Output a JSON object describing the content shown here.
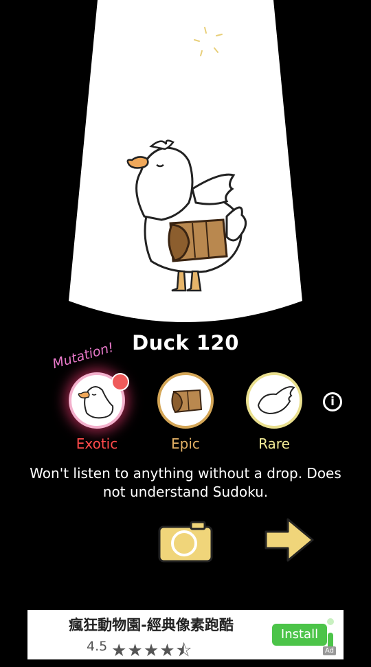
{
  "creature": {
    "name": "Duck 120",
    "mutation_label": "Mutation!"
  },
  "traits": [
    {
      "label": "Exotic",
      "rarity_color": "#ff4b4b",
      "icon": "duck-head-icon",
      "has_notification": true
    },
    {
      "label": "Epic",
      "rarity_color": "#e3b165",
      "icon": "wooden-barrel-icon"
    },
    {
      "label": "Rare",
      "rarity_color": "#f3ec97",
      "icon": "wing-icon"
    }
  ],
  "info_icon": "info-icon",
  "description": "Won't listen to anything without a drop. Does not understand Sudoku.",
  "actions": {
    "camera_icon": "camera-icon",
    "next_icon": "arrow-right-icon"
  },
  "ad": {
    "title": "瘋狂動物園-經典像素跑酷",
    "rating": "4.5",
    "stars_value": 4.5,
    "install_label": "Install",
    "ad_badge": "Ad"
  },
  "colors": {
    "background": "#000000",
    "accent_yellow": "#f0d57a",
    "spotlight": "#ffffff"
  }
}
